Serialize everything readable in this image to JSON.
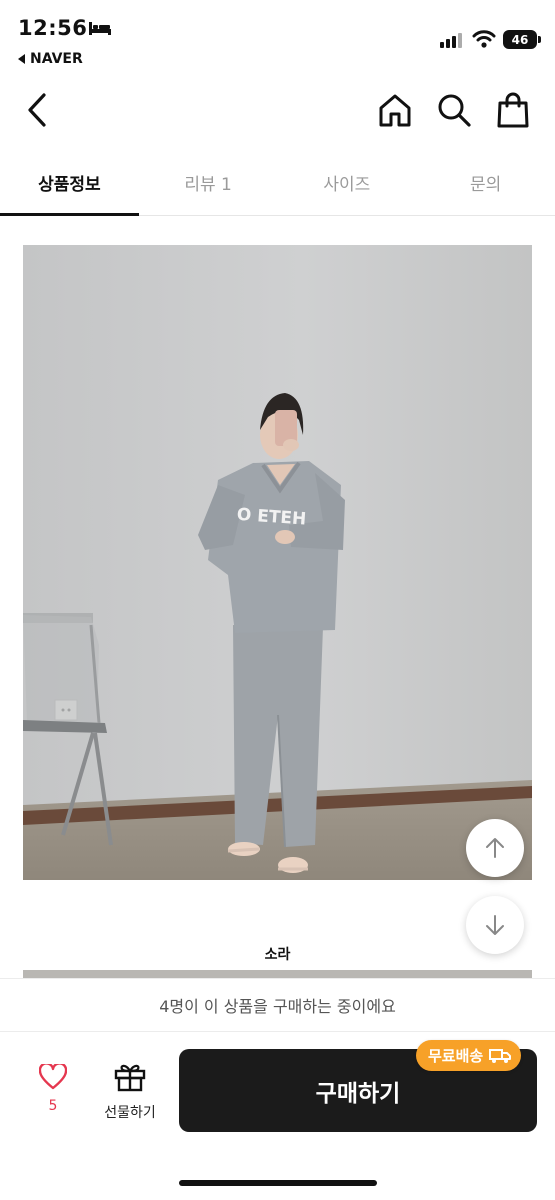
{
  "status_bar": {
    "time": "12:56",
    "back_app": "NAVER",
    "battery": "46"
  },
  "nav": {
    "icons": [
      "back-icon",
      "home-icon",
      "search-icon",
      "shopping-bag-icon"
    ]
  },
  "tabs": [
    {
      "label": "상품정보",
      "active": true
    },
    {
      "label": "리뷰 1",
      "active": false
    },
    {
      "label": "사이즈",
      "active": false
    },
    {
      "label": "문의",
      "active": false
    }
  ],
  "product": {
    "photo_caption": "소라"
  },
  "bottom": {
    "notice": "4명이 이 상품을 구매하는 중이에요",
    "like_count": "5",
    "gift_label": "선물하기",
    "buy_label": "구매하기",
    "shipping_badge": "무료배송"
  },
  "colors": {
    "accent_red": "#e5374f",
    "buy_button": "#1b1b1b",
    "shipping_badge": "#f7a128"
  }
}
